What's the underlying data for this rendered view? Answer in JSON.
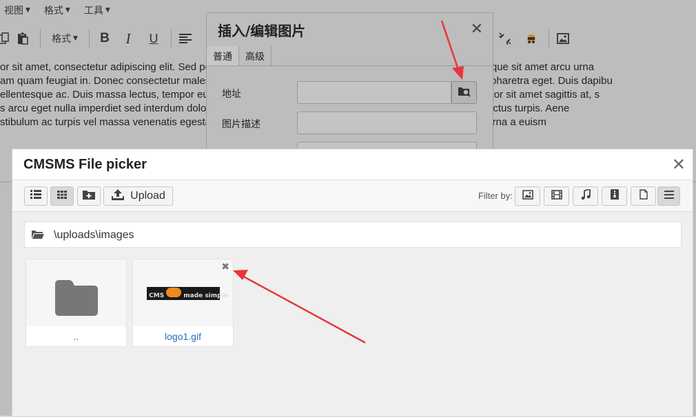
{
  "editor": {
    "menus": [
      "视图",
      "格式",
      "工具"
    ],
    "toolbar": {
      "format_label": "格式",
      "bold": "B",
      "italic": "I",
      "underline": "U"
    },
    "content_lines": [
      "or sit amet, consectetur adipiscing elit. Sed porttitor non orci vel bibendum. Curabitur feugiat eget erat. Quisque sit amet arcu urna",
      "am quam feugiat in. Donec consectetur malesuada enim, non mattis lorem sodales quis. Nunc facilisis erat pharetra eget. Duis dapibu",
      "ellentesque ac. Duis massa lectus, tempor eu dolor quis, fermentum lacinia tellus. Vivamus nisl libero, porttitor sit amet sagittis at, s",
      "s arcu eget nulla imperdiet sed interdum dolor lacinia. Nulla facilisi. Donec id dignissim nisl. Quisque vitae luctus turpis. Aene",
      "stibulum ac turpis vel massa venenatis egestas sed quis libero. Cras quis leo ut. Aliquam sagittis interdum urna a euism"
    ]
  },
  "image_dialog": {
    "title": "插入/编辑图片",
    "tabs": [
      "普通",
      "高级"
    ],
    "source_label": "地址",
    "description_label": "图片描述",
    "source_value": "",
    "description_value": ""
  },
  "picker": {
    "title": "CMSMS File picker",
    "upload_label": "Upload",
    "filter_label": "Filter by:",
    "current_path": "\\uploads\\images",
    "files": [
      {
        "name": "..",
        "type": "folder"
      },
      {
        "name": "logo1.gif",
        "type": "image",
        "logo_text": "CMS  made simple"
      }
    ]
  },
  "colors": {
    "annotation_arrow": "#e8353b",
    "link": "#2a6fb5",
    "folder_icon": "#777777",
    "logo_badge": "#f08a1c"
  }
}
